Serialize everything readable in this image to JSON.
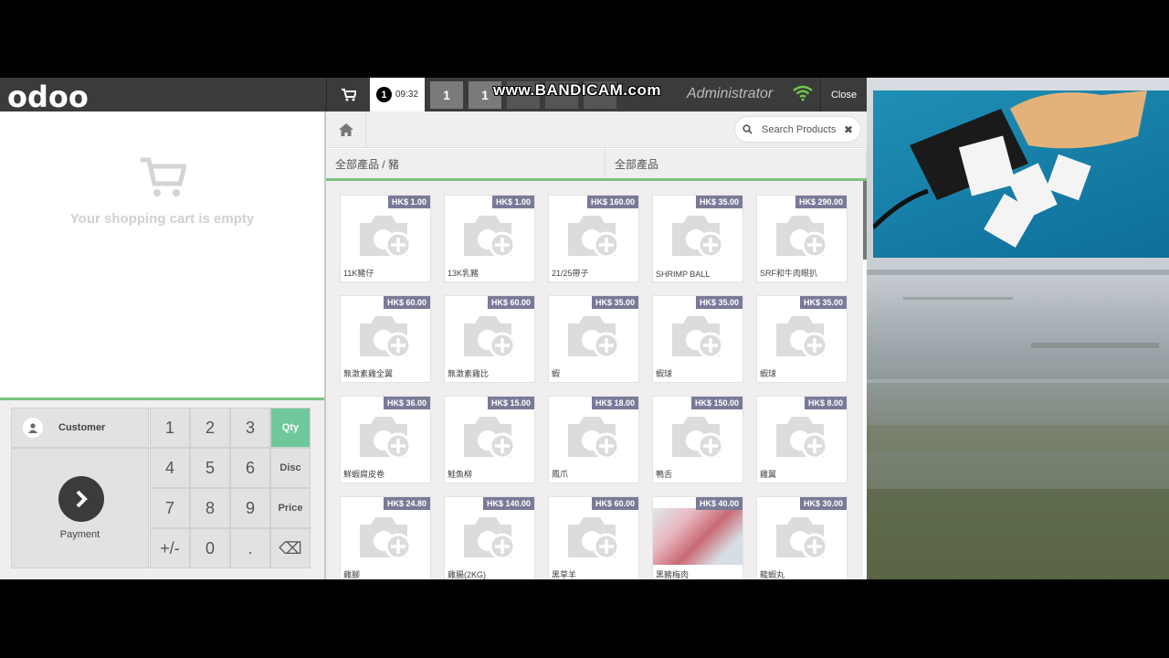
{
  "topbar": {
    "logo": "odoo",
    "active_order_number": "1",
    "active_order_time": "09:32",
    "order_tabs": [
      "1",
      "1",
      "",
      "",
      ""
    ],
    "watermark": "www.BANDICAM.com",
    "username": "Administrator",
    "close_label": "Close"
  },
  "cart": {
    "empty_message": "Your shopping cart is empty"
  },
  "actionpad": {
    "customer_label": "Customer",
    "payment_label": "Payment"
  },
  "numpad": {
    "keys": [
      "1",
      "2",
      "3",
      "Qty",
      "4",
      "5",
      "6",
      "Disc",
      "7",
      "8",
      "9",
      "Price",
      "+/-",
      "0",
      ".",
      "⌫"
    ]
  },
  "search": {
    "placeholder": "Search Products",
    "clear": "✖"
  },
  "categories": {
    "breadcrumb": "全部產品 / 豬",
    "all": "全部產品"
  },
  "products": [
    {
      "price": "HK$ 1.00",
      "name": "11K豬仔"
    },
    {
      "price": "HK$ 1.00",
      "name": "13K乳豬"
    },
    {
      "price": "HK$ 160.00",
      "name": "21/25帶子"
    },
    {
      "price": "HK$ 35.00",
      "name": "SHRIMP BALL"
    },
    {
      "price": "HK$ 290.00",
      "name": "SRF和牛肉眼扒"
    },
    {
      "price": "HK$ 60.00",
      "name": "無激素雞全翼"
    },
    {
      "price": "HK$ 60.00",
      "name": "無激素雞比"
    },
    {
      "price": "HK$ 35.00",
      "name": "蝦"
    },
    {
      "price": "HK$ 35.00",
      "name": "蝦球"
    },
    {
      "price": "HK$ 35.00",
      "name": "蝦球"
    },
    {
      "price": "HK$ 36.00",
      "name": "鮮蝦腐皮卷"
    },
    {
      "price": "HK$ 15.00",
      "name": "鮭魚柳"
    },
    {
      "price": "HK$ 18.00",
      "name": "鳳爪"
    },
    {
      "price": "HK$ 150.00",
      "name": "鴨舌"
    },
    {
      "price": "HK$ 8.00",
      "name": "雞翼"
    },
    {
      "price": "HK$ 24.80",
      "name": "雞腳"
    },
    {
      "price": "HK$ 140.00",
      "name": "雞腸(2KG)"
    },
    {
      "price": "HK$ 60.00",
      "name": "黑草羊"
    },
    {
      "price": "HK$ 40.00",
      "name": "黑豬梅肉",
      "photo": true
    },
    {
      "price": "HK$ 30.00",
      "name": "龍蝦丸"
    }
  ],
  "colors": {
    "accent_green": "#7ac47f",
    "qty_selected": "#6ec89b",
    "price_tag": "#7a7a98",
    "topbar": "#3b3b3b"
  }
}
